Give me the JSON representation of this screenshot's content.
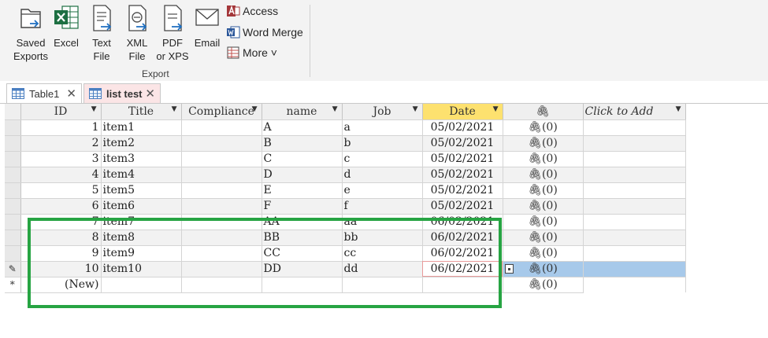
{
  "ribbon": {
    "buttons": [
      {
        "label": "Saved\nExports",
        "icon": "saved-exports-icon"
      },
      {
        "label": "Excel",
        "icon": "excel-icon"
      },
      {
        "label": "Text\nFile",
        "icon": "text-file-icon"
      },
      {
        "label": "XML\nFile",
        "icon": "xml-file-icon"
      },
      {
        "label": "PDF\nor XPS",
        "icon": "pdf-icon"
      },
      {
        "label": "Email",
        "icon": "email-icon"
      }
    ],
    "small": {
      "access": "Access",
      "word_merge": "Word Merge",
      "more": "More ˅"
    },
    "group_label": "Export"
  },
  "tabs": [
    {
      "label": "Table1",
      "close": "✕"
    },
    {
      "label": "list test",
      "close": "✕"
    }
  ],
  "table": {
    "headers": [
      "ID",
      "Title",
      "Compliance",
      "name",
      "Job",
      "Date",
      "",
      "Click to Add"
    ],
    "rows": [
      {
        "id": "1",
        "title": "item1",
        "compliance": "",
        "name": "A",
        "job": "a",
        "date": "05/02/2021",
        "att": "(0)"
      },
      {
        "id": "2",
        "title": "item2",
        "compliance": "",
        "name": "B",
        "job": "b",
        "date": "05/02/2021",
        "att": "(0)"
      },
      {
        "id": "3",
        "title": "item3",
        "compliance": "",
        "name": "C",
        "job": "c",
        "date": "05/02/2021",
        "att": "(0)"
      },
      {
        "id": "4",
        "title": "item4",
        "compliance": "",
        "name": "D",
        "job": "d",
        "date": "05/02/2021",
        "att": "(0)"
      },
      {
        "id": "5",
        "title": "item5",
        "compliance": "",
        "name": "E",
        "job": "e",
        "date": "05/02/2021",
        "att": "(0)"
      },
      {
        "id": "6",
        "title": "item6",
        "compliance": "",
        "name": "F",
        "job": "f",
        "date": "05/02/2021",
        "att": "(0)"
      },
      {
        "id": "7",
        "title": "item7",
        "compliance": "",
        "name": "AA",
        "job": "aa",
        "date": "06/02/2021",
        "att": "(0)"
      },
      {
        "id": "8",
        "title": "item8",
        "compliance": "",
        "name": "BB",
        "job": "bb",
        "date": "06/02/2021",
        "att": "(0)"
      },
      {
        "id": "9",
        "title": "item9",
        "compliance": "",
        "name": "CC",
        "job": "cc",
        "date": "06/02/2021",
        "att": "(0)"
      },
      {
        "id": "10",
        "title": "item10",
        "compliance": "",
        "name": "DD",
        "job": "dd",
        "date": "06/02/2021",
        "att": "(0)"
      }
    ],
    "new_row": {
      "id": "(New)",
      "att": "(0)"
    },
    "current_row_index": 9,
    "current_selector": "✎",
    "new_selector": "*"
  },
  "colors": {
    "highlight": "#27a443",
    "date_header": "#fde16f",
    "active_tab": "#fbe5e6",
    "selected_row": "#a7c9ea"
  }
}
